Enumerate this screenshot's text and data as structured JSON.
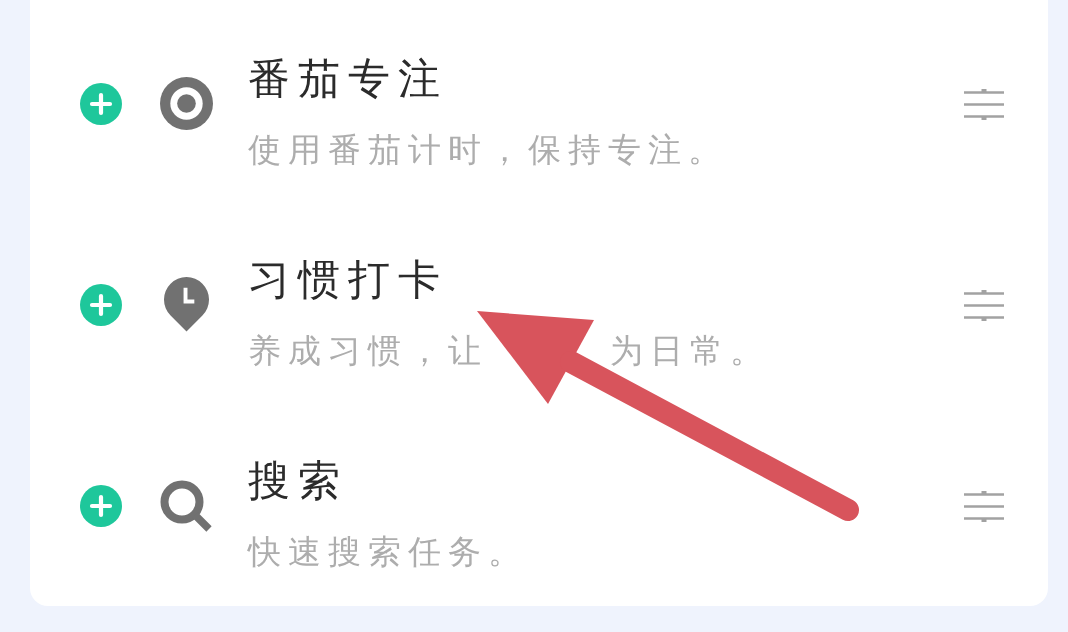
{
  "items": [
    {
      "kind": "focus",
      "title": "番茄专注",
      "description": [
        "使用番茄计时，保持专注。"
      ]
    },
    {
      "kind": "habit",
      "title": "习惯打卡",
      "description": [
        "养成习惯，让",
        "为日常。"
      ]
    },
    {
      "kind": "search",
      "title": "搜索",
      "description": [
        "快速搜索任务。"
      ]
    }
  ],
  "annotations": [
    {
      "kind": "arrow"
    }
  ]
}
